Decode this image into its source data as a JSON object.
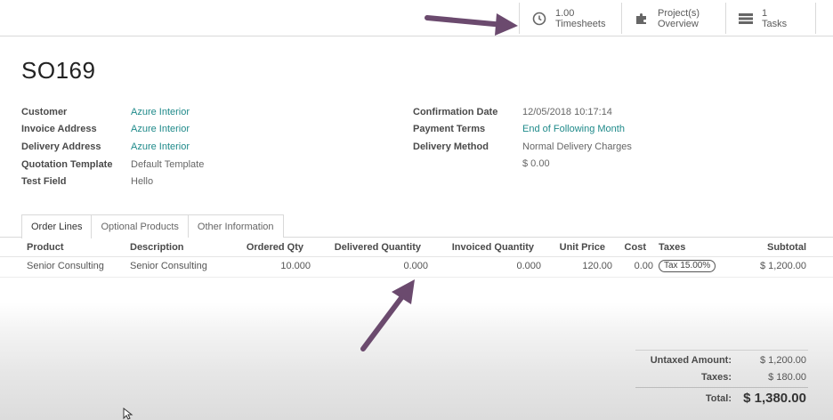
{
  "stat_buttons": [
    {
      "value": "1.00",
      "label": "Timesheets",
      "icon": "clock-icon"
    },
    {
      "value": "Project(s)",
      "label": "Overview",
      "icon": "puzzle-icon"
    },
    {
      "value": "1",
      "label": "Tasks",
      "icon": "tasks-icon"
    }
  ],
  "record": {
    "title": "SO169"
  },
  "left_fields": [
    {
      "label": "Customer",
      "value": "Azure Interior"
    },
    {
      "label": "Invoice Address",
      "value": "Azure Interior"
    },
    {
      "label": "Delivery Address",
      "value": "Azure Interior"
    },
    {
      "label": "Quotation Template",
      "value": "Default Template"
    },
    {
      "label": "Test Field",
      "value": "Hello"
    }
  ],
  "right_fields": [
    {
      "label": "Confirmation Date",
      "value": "12/05/2018 10:17:14"
    },
    {
      "label": "Payment Terms",
      "value": "End of Following Month"
    },
    {
      "label": "Delivery Method",
      "value": "Normal Delivery Charges"
    },
    {
      "label": "",
      "value": "$ 0.00"
    }
  ],
  "tabs": [
    "Order Lines",
    "Optional Products",
    "Other Information"
  ],
  "table": {
    "headers": [
      "Product",
      "Description",
      "Ordered Qty",
      "Delivered Quantity",
      "Invoiced Quantity",
      "Unit Price",
      "Cost",
      "Taxes",
      "Subtotal"
    ],
    "rows": [
      {
        "product": "Senior Consulting",
        "description": "Senior Consulting",
        "ordered_qty": "10.000",
        "delivered_qty": "0.000",
        "invoiced_qty": "0.000",
        "unit_price": "120.00",
        "cost": "0.00",
        "taxes": "Tax 15.00%",
        "subtotal": "$ 1,200.00"
      }
    ]
  },
  "totals": {
    "untaxed_label": "Untaxed Amount:",
    "untaxed_value": "$ 1,200.00",
    "taxes_label": "Taxes:",
    "taxes_value": "$ 180.00",
    "total_label": "Total:",
    "total_value": "$ 1,380.00"
  },
  "colors": {
    "link": "#1f8a8a",
    "arrow": "#6b4a6e"
  }
}
